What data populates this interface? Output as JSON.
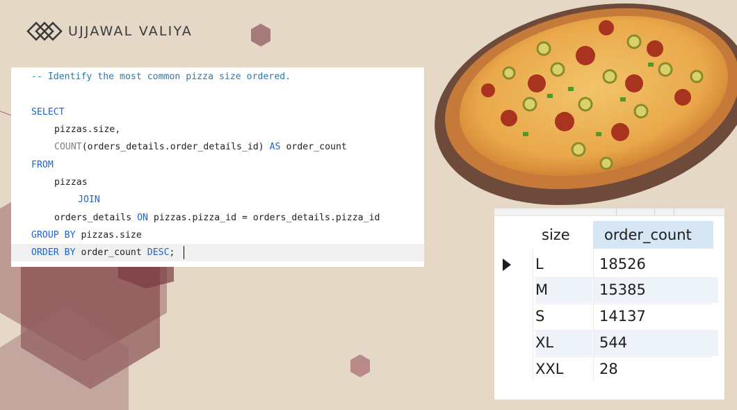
{
  "brand": {
    "name": "UJJAWAL VALIYA",
    "logo_icon": "interlocking-diamond-logo-icon"
  },
  "colors": {
    "background": "#e6d8c6",
    "hexagon": "#7a3a40",
    "sql_keyword": "#1f62c8",
    "sql_comment": "#2b7aa8",
    "header_highlight": "#d7e6f5"
  },
  "sql_editor": {
    "comment": "-- Identify the most common pizza size ordered.",
    "select_kw": "SELECT",
    "col1": "pizzas.size,",
    "count_fn": "COUNT",
    "count_arg": "(orders_details.order_details_id) ",
    "as_kw": "AS",
    "alias": " order_count",
    "from_kw": "FROM",
    "table1": "pizzas",
    "join_kw": "JOIN",
    "table2": "orders_details ",
    "on_kw": "ON",
    "on_cond": " pizzas.pizza_id = orders_details.pizza_id",
    "group_kw": "GROUP BY",
    "group_col": " pizzas.size",
    "order_kw": "ORDER BY",
    "order_col": " order_count ",
    "desc_kw": "DESC",
    "semicolon": ";"
  },
  "results_grid": {
    "columns": [
      "size",
      "order_count"
    ],
    "rows": [
      {
        "size": "L",
        "order_count": "18526"
      },
      {
        "size": "M",
        "order_count": "15385"
      },
      {
        "size": "S",
        "order_count": "14137"
      },
      {
        "size": "XL",
        "order_count": "544"
      },
      {
        "size": "XXL",
        "order_count": "28"
      }
    ],
    "current_row_indicator_icon": "row-pointer-triangle-icon"
  },
  "pizza_image": {
    "description_icon": "pizza-photo"
  }
}
